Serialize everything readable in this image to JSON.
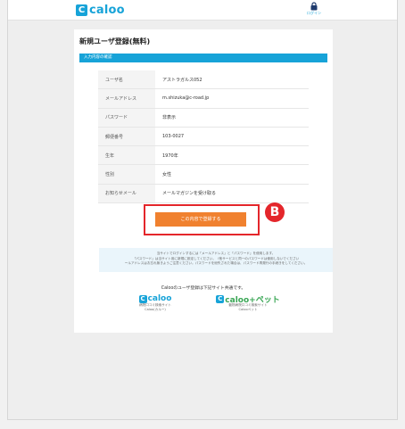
{
  "header": {
    "logo_mark": "C",
    "logo_text": "caloo",
    "login_label": "ログイン"
  },
  "page_title": "新規ユーザ登録(無料)",
  "section_title": "入力内容の確認",
  "rows": [
    {
      "label": "ユーザ名",
      "value": "アストラガルス052"
    },
    {
      "label": "メールアドレス",
      "value": "m.shizuka@c-road.jp"
    },
    {
      "label": "パスワード",
      "value": "非表示"
    },
    {
      "label": "郵便番号",
      "value": "103-0027"
    },
    {
      "label": "生年",
      "value": "1970年"
    },
    {
      "label": "性別",
      "value": "女性"
    },
    {
      "label": "お知らせメール",
      "value": "メールマガジンを受け取る"
    }
  ],
  "submit_label": "この内容で登録する",
  "badge": "B",
  "notice": [
    "当サイトでログインするには「メールアドレス」と「パスワード」を使用します。",
    "「パスワード」は当サイト用に新規に設定してください。（他サービスと同一のパスワードは使用しないでください",
    "ールアドレスはお忘れ無きようご注意ください。パスワードを紛失された場合は、パスワード再発行の手続きをしてください。"
  ],
  "common_text": "Calooのユーザ登録は下記サイト共通です。",
  "brands": [
    {
      "mark": "C",
      "name": "caloo",
      "desc1": "病院口コミ検索サイト",
      "desc2": "Caloo(カルー)"
    },
    {
      "mark": "C",
      "name": "caloo+ペット",
      "desc1": "動物病院口コミ検索サイト",
      "desc2": "Calooペット"
    }
  ],
  "colors": {
    "brand_blue": "#17a3d8",
    "cta_orange": "#f0812f",
    "highlight_red": "#e4262b",
    "pet_green": "#3aa655"
  }
}
